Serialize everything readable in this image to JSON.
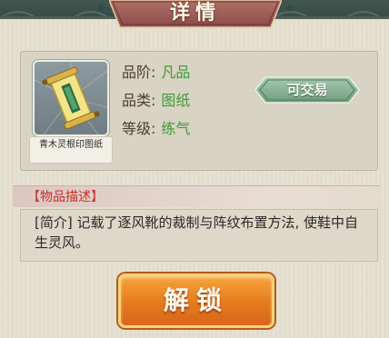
{
  "header": {
    "title": "详情"
  },
  "item": {
    "name": "青木灵根印图纸",
    "icon": "scroll-icon",
    "properties": [
      {
        "label": "品阶:",
        "value": "凡品"
      },
      {
        "label": "品类:",
        "value": "图纸"
      },
      {
        "label": "等级:",
        "value": "练气"
      }
    ],
    "trade_status": "可交易"
  },
  "description": {
    "title": "【物品描述】",
    "text": "[简介] 记载了逐风靴的裁制与阵纹布置方法, 使鞋中自生灵风。"
  },
  "actions": {
    "unlock_label": "解锁"
  },
  "colors": {
    "value_green": "#3f9a3a",
    "desc_title_red": "#c6322c",
    "button_orange": "#e57b1d",
    "badge_green": "#7fae8d"
  }
}
